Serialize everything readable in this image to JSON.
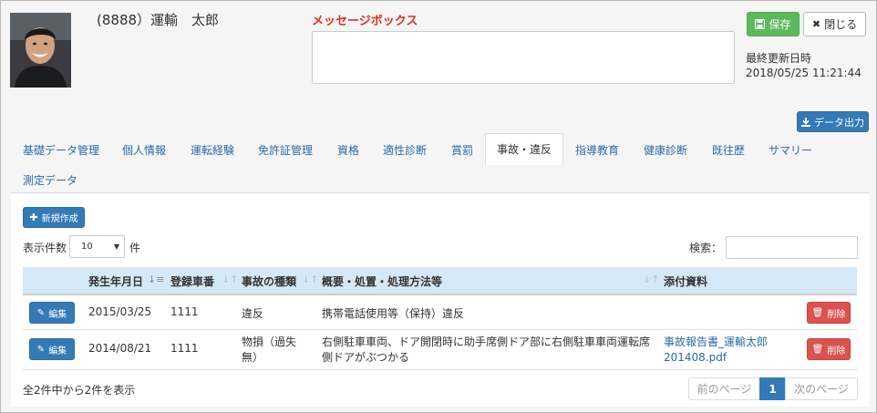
{
  "header": {
    "employee_name": "(8888）運輸　太郎",
    "message_label": "メッセージボックス",
    "save_label": "保存",
    "close_label": "閉じる",
    "last_updated_label": "最終更新日時",
    "last_updated_value": "2018/05/25 11:21:44",
    "export_label": "データ出力"
  },
  "tabs": [
    {
      "label": "基礎データ管理",
      "active": false
    },
    {
      "label": "個人情報",
      "active": false
    },
    {
      "label": "運転経験",
      "active": false
    },
    {
      "label": "免許証管理",
      "active": false
    },
    {
      "label": "資格",
      "active": false
    },
    {
      "label": "適性診断",
      "active": false
    },
    {
      "label": "賞罰",
      "active": false
    },
    {
      "label": "事故・違反",
      "active": true
    },
    {
      "label": "指導教育",
      "active": false
    },
    {
      "label": "健康診断",
      "active": false
    },
    {
      "label": "既往歴",
      "active": false
    },
    {
      "label": "サマリー",
      "active": false
    },
    {
      "label": "測定データ",
      "active": false
    }
  ],
  "toolbar": {
    "new_label": "新規作成",
    "page_size_label": "表示件数",
    "page_size_value": "10",
    "page_size_suffix": "件",
    "search_label": "検索："
  },
  "table": {
    "columns": [
      "発生年月日",
      "登録車番",
      "事故の種類",
      "概要・処置・処理方法等",
      "添付資料"
    ],
    "rows": [
      {
        "edit_label": "編集",
        "date": "2015/03/25",
        "vehicle": "1111",
        "type": "違反",
        "summary": "携帯電話使用等（保持）違反",
        "attachment": "",
        "delete_label": "削除"
      },
      {
        "edit_label": "編集",
        "date": "2014/08/21",
        "vehicle": "1111",
        "type": "物損（過失無）",
        "summary": "右側駐車車両、ドア開閉時に助手席側ドア部に右側駐車車両運転席側ドアがぶつかる",
        "attachment": "事故報告書_運輸太郎201408.pdf",
        "delete_label": "削除"
      }
    ]
  },
  "footer": {
    "info": "全2件中から2件を表示",
    "prev_label": "前のページ",
    "current_page": "1",
    "next_label": "次のページ"
  },
  "colors": {
    "primary": "#337ab7",
    "success": "#5cb85c",
    "danger": "#d9534f",
    "message_label": "#e0301e",
    "table_header": "#d5e8f5"
  }
}
